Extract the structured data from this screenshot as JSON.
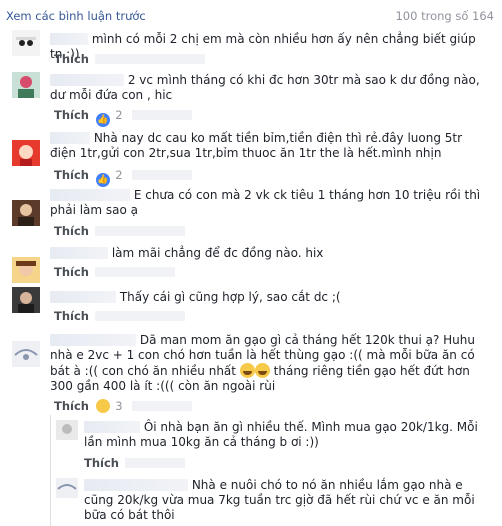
{
  "header": {
    "prev_link": "Xem các bình luận trước",
    "count": "100 trong số 164"
  },
  "colors": {
    "link": "#365899",
    "meta": "#90949c",
    "like_blue": "#4080ff"
  },
  "comments": [
    {
      "text": "mình có mỗi 2 chị em mà còn nhiều hơn ấy nên chẳng biết giúp tn ;))",
      "like": "Thích"
    },
    {
      "text": "2 vc mình tháng có khi đc hơn 30tr mà sao k dư đồng nào, dư mỗi đứa con , hic",
      "like": "Thích",
      "reaction_count": "2"
    },
    {
      "text": "Nhà nay dc cau ko mất tiền bỉm,tiền điện thì rẻ.đây luong 5tr điện 1tr,gửi con 2tr,sua 1tr,bỉm thuoc ăn 1tr the là hết.mình nhịn",
      "like": "Thích",
      "reaction_count": "2"
    },
    {
      "text": "E chưa có con mà 2 vk ck tiêu 1 tháng hơn 10 triệu rồi thì phải làm sao ạ",
      "like": "Thích"
    },
    {
      "text": "làm mãi chẳng để đc đồng nào. hix",
      "like": "Thích"
    },
    {
      "text": "Thấy cái gì cũng hợp lý, sao cắt dc ;(",
      "like": "Thích"
    },
    {
      "text_a": "Dã man mom ăn gạo gì cả tháng hết 120k thui ạ? Huhu nhà e 2vc + 1 con chó hơn tuần là hết thùng gạo :(( mà mỗi bữa ăn có bát à :(( con chó ăn nhiều nhất",
      "text_b": "tháng riêng tiền gạo hết đứt hơn 300 gần 400 là ít :((( còn ăn ngoài rùi",
      "like": "Thích",
      "reaction_count": "3"
    },
    {
      "text": "Ôi nhà bạn ăn gì nhiều thế. Mình mua gạo 20k/1kg. Mỗi lần mình mua 10kg ăn cả tháng b ơi :))",
      "like": "Thích"
    },
    {
      "text": "Nhà e nuôi chó to nó ăn nhiều lắm gạo nhà e cũng 20k/kg vừa mua 7kg tuần trc gịờ đã hết rùi chứ vc e ăn mỗi bữa có bát thôi"
    }
  ]
}
